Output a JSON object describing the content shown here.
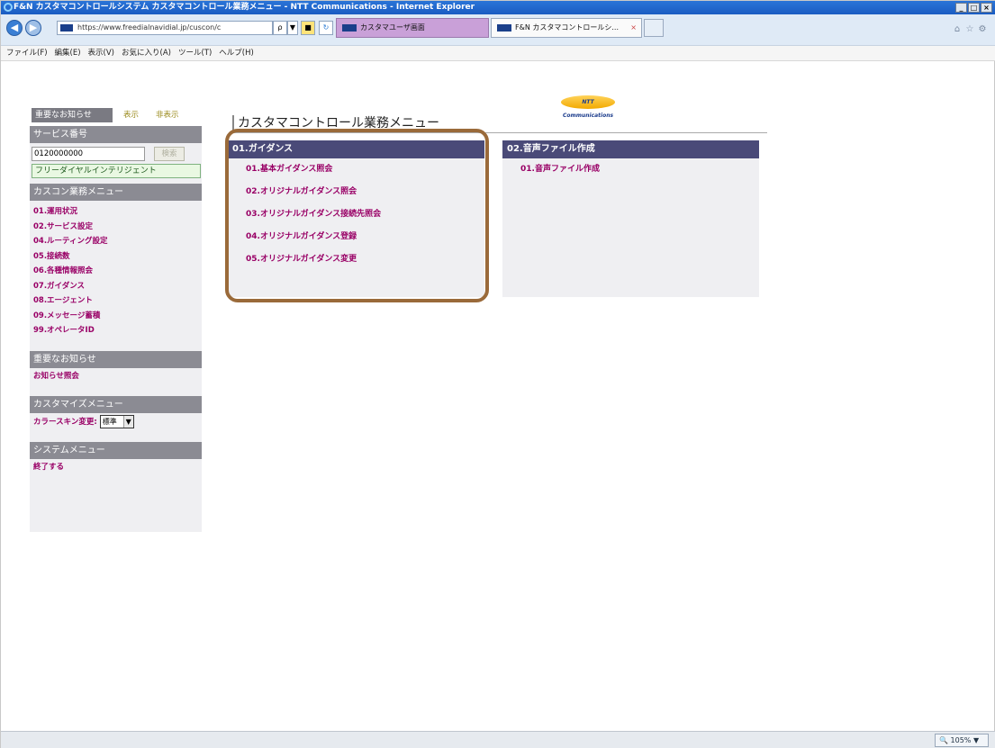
{
  "window": {
    "title": "F&N カスタマコントロールシステム カスタマコントロール業務メニュー - NTT Communications - Internet Explorer",
    "controls": [
      "_",
      "□",
      "×"
    ]
  },
  "address_bar": {
    "url": "https://www.freedialnavidial.jp/cuscon/c",
    "search_glyph": "ρ",
    "tabs": [
      {
        "label": "カスタマユーザ画面",
        "active": false
      },
      {
        "label": "F&N カスタマコントロールシ...",
        "active": true
      }
    ]
  },
  "menubar": [
    "ファイル(F)",
    "編集(E)",
    "表示(V)",
    "お気に入り(A)",
    "ツール(T)",
    "ヘルプ(H)"
  ],
  "logo_text": "NTT Communications",
  "sidebar": {
    "notice_header": "重要なお知らせ",
    "show_label": "表示",
    "hide_label": "非表示",
    "service_header": "サービス番号",
    "service_value": "0120000000",
    "search_button": "検索",
    "service_type": "フリーダイヤルインテリジェント",
    "menu_header": "カスコン業務メニュー",
    "menu_items": [
      "01.運用状況",
      "02.サービス設定",
      "04.ルーティング設定",
      "05.接続数",
      "06.各種情報照会",
      "07.ガイダンス",
      "08.エージェント",
      "09.メッセージ蓄積",
      "99.オペレータID"
    ],
    "important_header": "重要なお知らせ",
    "important_link": "お知らせ照会",
    "customize_header": "カスタマイズメニュー",
    "skin_label": "カラースキン変更:",
    "skin_value": "標準",
    "system_header": "システムメニュー",
    "exit_link": "終了する"
  },
  "main": {
    "title": "カスタマコントロール業務メニュー",
    "panels": [
      {
        "header": "01.ガイダンス",
        "links": [
          "01.基本ガイダンス照会",
          "02.オリジナルガイダンス照会",
          "03.オリジナルガイダンス接続先照会",
          "04.オリジナルガイダンス登録",
          "05.オリジナルガイダンス変更"
        ]
      },
      {
        "header": "02.音声ファイル作成",
        "links": [
          "01.音声ファイル作成"
        ]
      }
    ]
  },
  "status": {
    "zoom": "105%"
  },
  "colors": {
    "link": "#990066",
    "panel_header": "#4a4a78",
    "highlight_border": "#9a6a3a"
  }
}
